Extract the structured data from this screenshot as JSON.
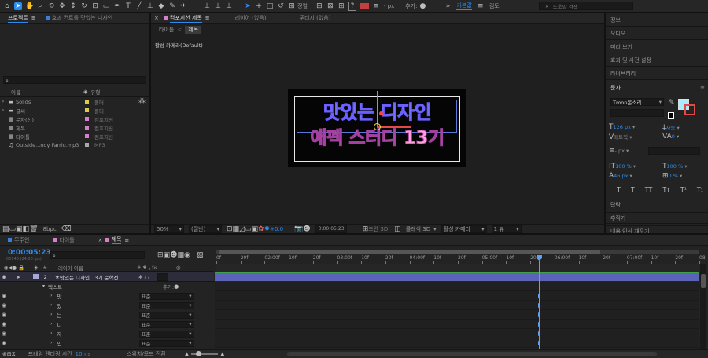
{
  "toolbar": {
    "align_label": "정렬",
    "add_label": "추가:",
    "px_label": "- px",
    "workspace_default": "기본값",
    "workspace_review": "검토",
    "search_placeholder": "도움말 검색"
  },
  "project_panel": {
    "tab_label": "프로젝트",
    "effects_tab_label": "효과 컨트롤 맛있는 디자인",
    "col_name": "이름",
    "col_type": "유형",
    "items": [
      {
        "name": "Solids",
        "type": "폴더",
        "color": "#e0c84a"
      },
      {
        "name": "글씨",
        "type": "폴더",
        "color": "#e0c84a"
      },
      {
        "name": "문자(선)",
        "type": "컴포지션",
        "color": "#d77fc9"
      },
      {
        "name": "제목",
        "type": "컴포지션",
        "color": "#d77fc9"
      },
      {
        "name": "타이틀",
        "type": "컴포지션",
        "color": "#d77fc9"
      },
      {
        "name": "Outside...ndy Farrig.mp3",
        "type": "MP3",
        "color": "#a8a8a8"
      }
    ],
    "bpc": "8bpc"
  },
  "comp_panel": {
    "tab_prefix": "컴포지션",
    "tab_name": "제목",
    "layer_tab": "레이어 (없음)",
    "footage_tab": "푸티지 (없음)",
    "sub_tab_title": "타이틀",
    "sub_tab_active": "제목",
    "camera_label": "활성 카메라(Default)",
    "title_line1": "맛있는 디자인",
    "title_line2": "애펙 스터디 13기",
    "zoom": "50%",
    "quality": "(절반)",
    "timecode": "0:00:05:23",
    "renderer": "클래식 3D",
    "camera": "활성 카메라",
    "views": "1 뷰",
    "offset": "+0.0",
    "draft3d": "초안 3D"
  },
  "right_panel": {
    "items": [
      "정보",
      "오디오",
      "미리 보기",
      "효과 및 사전 설정",
      "라이브러리"
    ],
    "char_label": "문자",
    "font_name": "Tmon몬소리",
    "font_size": "126 px",
    "leading": "자동",
    "tracking_auto": "메트릭",
    "tracking": "0",
    "stroke": "- px",
    "v_scale": "100 %",
    "h_scale": "100 %",
    "baseline": "46 px",
    "tsume": "0 %",
    "styles": [
      "T",
      "T",
      "TT",
      "Tт",
      "T¹",
      "T₁"
    ],
    "bottom_items": [
      "단락",
      "추적기",
      "내용 인식 채우기"
    ]
  },
  "timeline": {
    "tabs": [
      {
        "label": "무주인",
        "color": "#3a7fd9",
        "active": false
      },
      {
        "label": "타이틀",
        "color": "#d77fc9",
        "active": false
      },
      {
        "label": "제목",
        "color": "#d77fc9",
        "active": true
      }
    ],
    "timecode": "0:00:05:23",
    "frame_info": "00143 (24.00 fps)",
    "col_source": "레이어 이름",
    "col_mode_header": "# ✱ \\ fx",
    "layer": {
      "index": "2",
      "name": "맛있는 디자인...3기 문학선"
    },
    "text_group": "텍스트",
    "add_label": "추가:",
    "chars": [
      "맛",
      "있",
      "는",
      "디",
      "자",
      "인"
    ],
    "blend": "표준",
    "ruler": [
      "0f",
      "20f",
      "02:00f",
      "10f",
      "20f",
      "03:00f",
      "10f",
      "20f",
      "04:00f",
      "10f",
      "20f",
      "05:00f",
      "10f",
      "20f",
      "06:00f",
      "10f",
      "20f",
      "07:00f",
      "10f",
      "20f",
      "08"
    ],
    "render_time_label": "프레임 렌더링 시간",
    "render_time": "10ms",
    "toggle_label": "스위치/모드 전환"
  }
}
